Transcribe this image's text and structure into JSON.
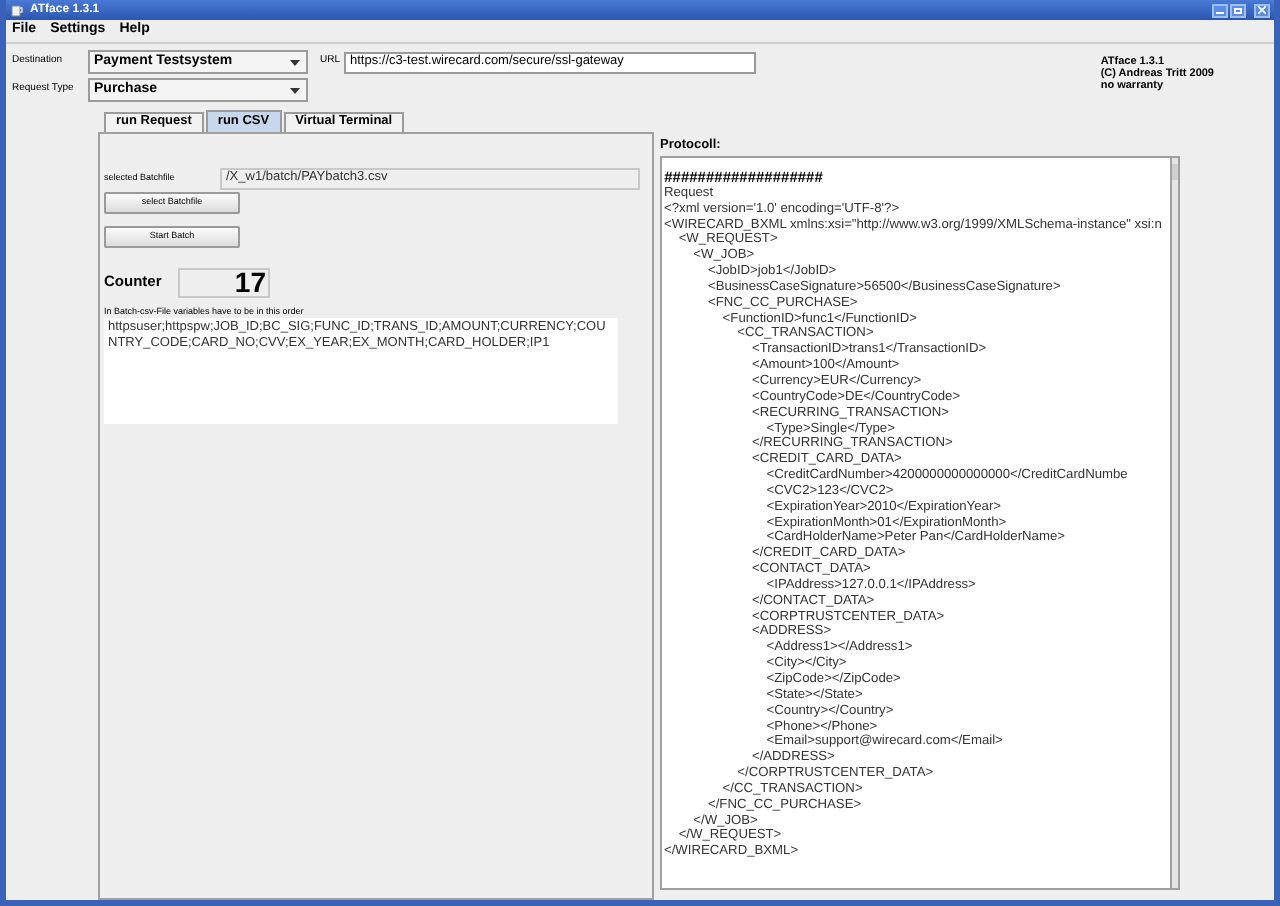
{
  "window": {
    "title": "ATface 1.3.1"
  },
  "menu": [
    "File",
    "Settings",
    "Help"
  ],
  "destination": {
    "label": "Destination",
    "value": "Payment Testsystem"
  },
  "url": {
    "label": "URL",
    "value": "https://c3-test.wirecard.com/secure/ssl-gateway"
  },
  "request_type": {
    "label": "Request Type",
    "value": "Purchase"
  },
  "about": [
    "ATface 1.3.1",
    "(C) Andreas Tritt 2009",
    "no warranty"
  ],
  "tabs": [
    {
      "label": "run Request",
      "selected": false
    },
    {
      "label": "run CSV",
      "selected": true
    },
    {
      "label": "Virtual Terminal",
      "selected": false
    }
  ],
  "batch": {
    "file_label": "selected Batchfile",
    "file": "/X_w1/batch/PAYbatch3.csv",
    "buttons": [
      "select Batchfile",
      "Start Batch"
    ],
    "counter_label": "Counter",
    "counter": "17",
    "order_note": "In Batch-csv-File variables have to be in this order",
    "order": "httpsuser;httpspw;JOB_ID;BC_SIG;FUNC_ID;TRANS_ID;AMOUNT;CURRENCY;COUNTRY_CODE;CARD_NO;CVV;EX_YEAR;EX_MONTH;CARD_HOLDER;IP1"
  },
  "protocol": {
    "label": "Protocoll:",
    "header": "###################",
    "lines": [
      "Request",
      "<?xml version='1.0' encoding='UTF-8'?>",
      "<WIRECARD_BXML xmlns:xsi=\"http://www.w3.org/1999/XMLSchema-instance\" xsi:n",
      "    <W_REQUEST>",
      "        <W_JOB>",
      "            <JobID>job1</JobID>",
      "            <BusinessCaseSignature>56500</BusinessCaseSignature>",
      "            <FNC_CC_PURCHASE>",
      "                <FunctionID>func1</FunctionID>",
      "                    <CC_TRANSACTION>",
      "                        <TransactionID>trans1</TransactionID>",
      "                        <Amount>100</Amount>",
      "                        <Currency>EUR</Currency>",
      "                        <CountryCode>DE</CountryCode>",
      "                        <RECURRING_TRANSACTION>",
      "                            <Type>Single</Type>",
      "                        </RECURRING_TRANSACTION>",
      "                        <CREDIT_CARD_DATA>",
      "                            <CreditCardNumber>4200000000000000</CreditCardNumbe",
      "                            <CVC2>123</CVC2>",
      "                            <ExpirationYear>2010</ExpirationYear>",
      "                            <ExpirationMonth>01</ExpirationMonth>",
      "                            <CardHolderName>Peter Pan</CardHolderName>",
      "                        </CREDIT_CARD_DATA>",
      "                        <CONTACT_DATA>",
      "                            <IPAddress>127.0.0.1</IPAddress>",
      "                        </CONTACT_DATA>",
      "                        <CORPTRUSTCENTER_DATA>",
      "                        <ADDRESS>",
      "                            <Address1></Address1>",
      "                            <City></City>",
      "                            <ZipCode></ZipCode>",
      "                            <State></State>",
      "                            <Country></Country>",
      "                            <Phone></Phone>",
      "                            <Email>support@wirecard.com</Email>",
      "                        </ADDRESS>",
      "                    </CORPTRUSTCENTER_DATA>",
      "                </CC_TRANSACTION>",
      "            </FNC_CC_PURCHASE>",
      "        </W_JOB>",
      "    </W_REQUEST>",
      "</WIRECARD_BXML>"
    ]
  }
}
